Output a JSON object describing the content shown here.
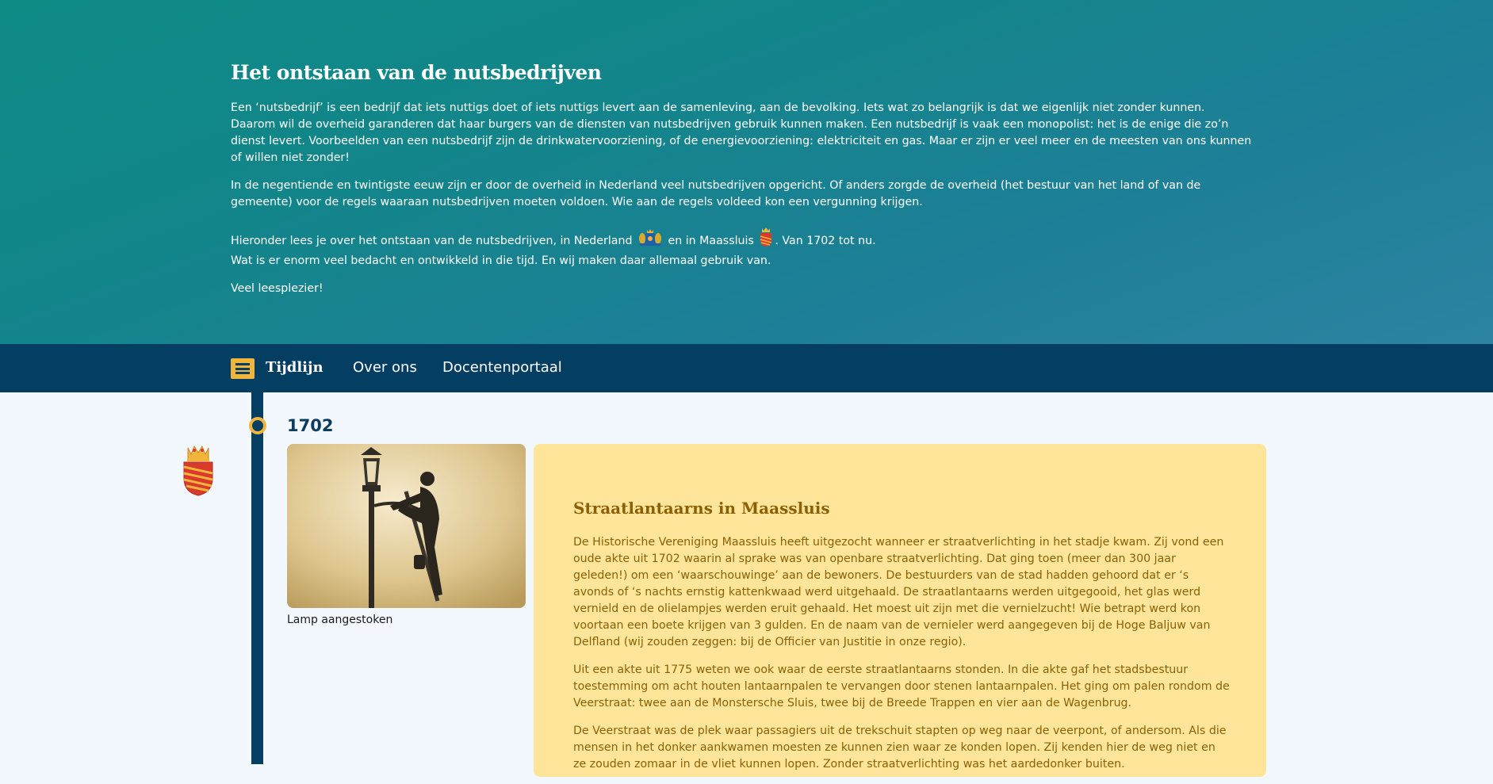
{
  "hero": {
    "title": "Het ontstaan van de nutsbedrijven",
    "p1_line1": "Een ‘nutsbedrijf’ is een bedrijf dat iets nuttigs doet of iets nuttigs levert aan de samenleving, aan de bevolking. Iets wat zo belangrijk is dat we eigenlijk niet zonder kunnen.",
    "p1_line2": "Daarom wil de overheid garanderen dat haar burgers van de diensten van nutsbedrijven gebruik kunnen maken. Een nutsbedrijf is vaak een monopolist: het is de enige die zo’n dienst levert. Voorbeelden van een nutsbedrijf zijn de drinkwatervoorziening, of de energievoorziening: elektriciteit en gas. Maar er zijn er veel meer en de meesten van ons kunnen of willen niet zonder!",
    "p2": "In de negentiende en twintigste eeuw zijn er door de overheid in Nederland veel nutsbedrijven opgericht. Of anders zorgde de overheid (het bestuur van het land of van de gemeente) voor de regels waaraan nutsbedrijven moeten voldoen. Wie aan de regels voldeed kon een vergunning krijgen.",
    "p3_part1": "Hieronder lees je over het ontstaan van de nutsbedrijven, in Nederland",
    "p3_part2": "en in Maassluis",
    "p3_part3": ". Van 1702 tot nu.",
    "p3_line2": "Wat is er enorm veel bedacht en ontwikkeld in die tijd. En wij maken daar allemaal gebruik van.",
    "p4": "Veel leesplezier!"
  },
  "nav": {
    "brand": "Tijdlijn",
    "items": [
      "Over ons",
      "Docentenportaal"
    ]
  },
  "timeline": {
    "year": "1702",
    "photo_caption": "Lamp aangestoken",
    "card": {
      "title": "Straatlantaarns in Maassluis",
      "paragraphs": [
        "De Historische Vereniging Maassluis heeft uitgezocht wanneer er straatverlichting in het stadje kwam. Zij vond een oude akte uit 1702 waarin al sprake was van openbare straatverlichting. Dat ging toen (meer dan 300 jaar geleden!) om een ‘waarschouwinge’ aan de bewoners. De bestuurders van de stad hadden gehoord dat er ‘s avonds of ‘s nachts ernstig kattenkwaad werd uitgehaald. De straatlantaarns werden uitgegooid, het glas werd vernield en de olielampjes werden eruit gehaald. Het moest uit zijn met die vernielzucht! Wie betrapt werd kon voortaan een boete krijgen van 3 gulden. En de naam van de vernieler werd aangegeven bij de Hoge Baljuw van Delfland (wij zouden zeggen: bij de Officier van Justitie in onze regio).",
        "Uit een akte uit 1775 weten we ook waar de eerste straatlantaarns stonden. In die akte gaf het stadsbestuur toestemming om acht houten lantaarnpalen te vervangen door stenen lantaarnpalen. Het ging om palen rondom de Veerstraat: twee aan de Monstersche Sluis, twee bij de Breede Trappen en vier aan de Wagenbrug.",
        "De Veerstraat was de plek waar passagiers uit de trekschuit stapten op weg naar de veerpont, of andersom. Als die mensen in het donker aankwamen moesten ze kunnen zien waar ze konden lopen. Zij kenden hier de weg niet en ze zouden zomaar in de vliet kunnen lopen. Zonder straatverlichting was het aardedonker buiten."
      ]
    }
  },
  "icons": {
    "nederland_crest": "nederland-coat-of-arms-icon",
    "maassluis_crest": "maassluis-coat-of-arms-icon",
    "menu": "hamburger-menu-icon"
  },
  "colors": {
    "hero_teal": "#0e8a85",
    "navy": "#043e63",
    "accent_yellow": "#f2b53c",
    "card_bg": "#ffe59a",
    "card_text": "#8a6106"
  }
}
